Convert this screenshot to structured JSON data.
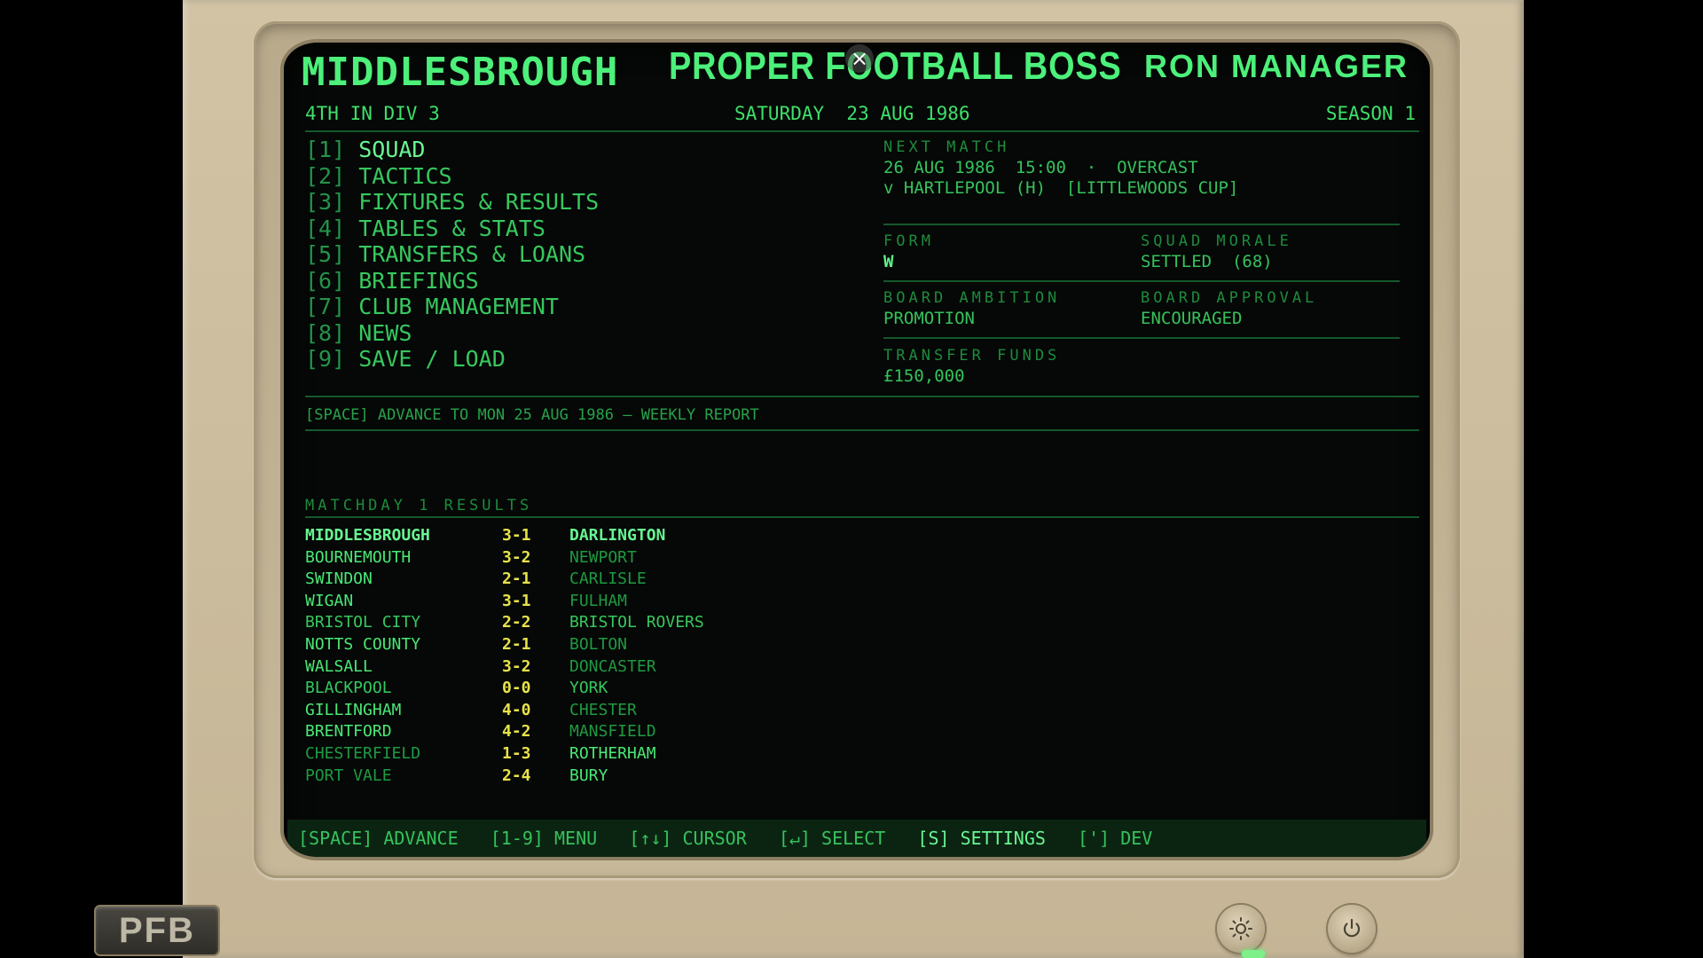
{
  "header": {
    "club": "MIDDLESBROUGH",
    "game_title": "PROPER FOOTBALL BOSS",
    "manager": "RON MANAGER",
    "close_glyph": "×",
    "position": "4TH IN DIV 3",
    "date": "SATURDAY  23 AUG 1986",
    "season": "SEASON 1"
  },
  "menu": [
    {
      "key": "[1]",
      "label": "SQUAD"
    },
    {
      "key": "[2]",
      "label": "TACTICS"
    },
    {
      "key": "[3]",
      "label": "FIXTURES & RESULTS"
    },
    {
      "key": "[4]",
      "label": "TABLES & STATS"
    },
    {
      "key": "[5]",
      "label": "TRANSFERS & LOANS"
    },
    {
      "key": "[6]",
      "label": "BRIEFINGS"
    },
    {
      "key": "[7]",
      "label": "CLUB MANAGEMENT"
    },
    {
      "key": "[8]",
      "label": "NEWS"
    },
    {
      "key": "[9]",
      "label": "SAVE / LOAD"
    }
  ],
  "status": {
    "next_match_label": "NEXT MATCH",
    "next_match_when": "26 AUG 1986  15:00  ·  OVERCAST",
    "next_match_vs": "v HARTLEPOOL (H)  [LITTLEWOODS CUP]",
    "form_label": "FORM",
    "form_value": "W",
    "morale_label": "SQUAD MORALE",
    "morale_value": "SETTLED  (68)",
    "ambition_label": "BOARD AMBITION",
    "ambition_value": "PROMOTION",
    "approval_label": "BOARD APPROVAL",
    "approval_value": "ENCOURAGED",
    "funds_label": "TRANSFER FUNDS",
    "funds_value": "£150,000"
  },
  "advance_hint": "[SPACE] ADVANCE TO MON 25 AUG 1986 — WEEKLY REPORT",
  "results": {
    "heading": "MATCHDAY 1 RESULTS",
    "rows": [
      {
        "home": "MIDDLESBROUGH",
        "score": "3-1",
        "away": "DARLINGTON"
      },
      {
        "home": "BOURNEMOUTH",
        "score": "3-2",
        "away": "NEWPORT"
      },
      {
        "home": "SWINDON",
        "score": "2-1",
        "away": "CARLISLE"
      },
      {
        "home": "WIGAN",
        "score": "3-1",
        "away": "FULHAM"
      },
      {
        "home": "BRISTOL CITY",
        "score": "2-2",
        "away": "BRISTOL ROVERS"
      },
      {
        "home": "NOTTS COUNTY",
        "score": "2-1",
        "away": "BOLTON"
      },
      {
        "home": "WALSALL",
        "score": "3-2",
        "away": "DONCASTER"
      },
      {
        "home": "BLACKPOOL",
        "score": "0-0",
        "away": "YORK"
      },
      {
        "home": "GILLINGHAM",
        "score": "4-0",
        "away": "CHESTER"
      },
      {
        "home": "BRENTFORD",
        "score": "4-2",
        "away": "MANSFIELD"
      },
      {
        "home": "CHESTERFIELD",
        "score": "1-3",
        "away": "ROTHERHAM"
      },
      {
        "home": "PORT VALE",
        "score": "2-4",
        "away": "BURY"
      }
    ]
  },
  "footer": {
    "advance": "[SPACE] ADVANCE",
    "menu": "[1-9] MENU",
    "cursor": "[↑↓] CURSOR",
    "select": "[↵] SELECT",
    "settings": "[S] SETTINGS",
    "dev": "['] DEV"
  },
  "cabinet": {
    "badge": "PFB",
    "brightness_icon": "sun-icon",
    "power_icon": "power-icon"
  },
  "colors": {
    "phosphor": "#2fd15a",
    "phosphor_bright": "#5cf08a",
    "score_yellow": "#e8e24a",
    "screen_bg": "#050806",
    "cabinet_beige": "#cbbc9d"
  }
}
